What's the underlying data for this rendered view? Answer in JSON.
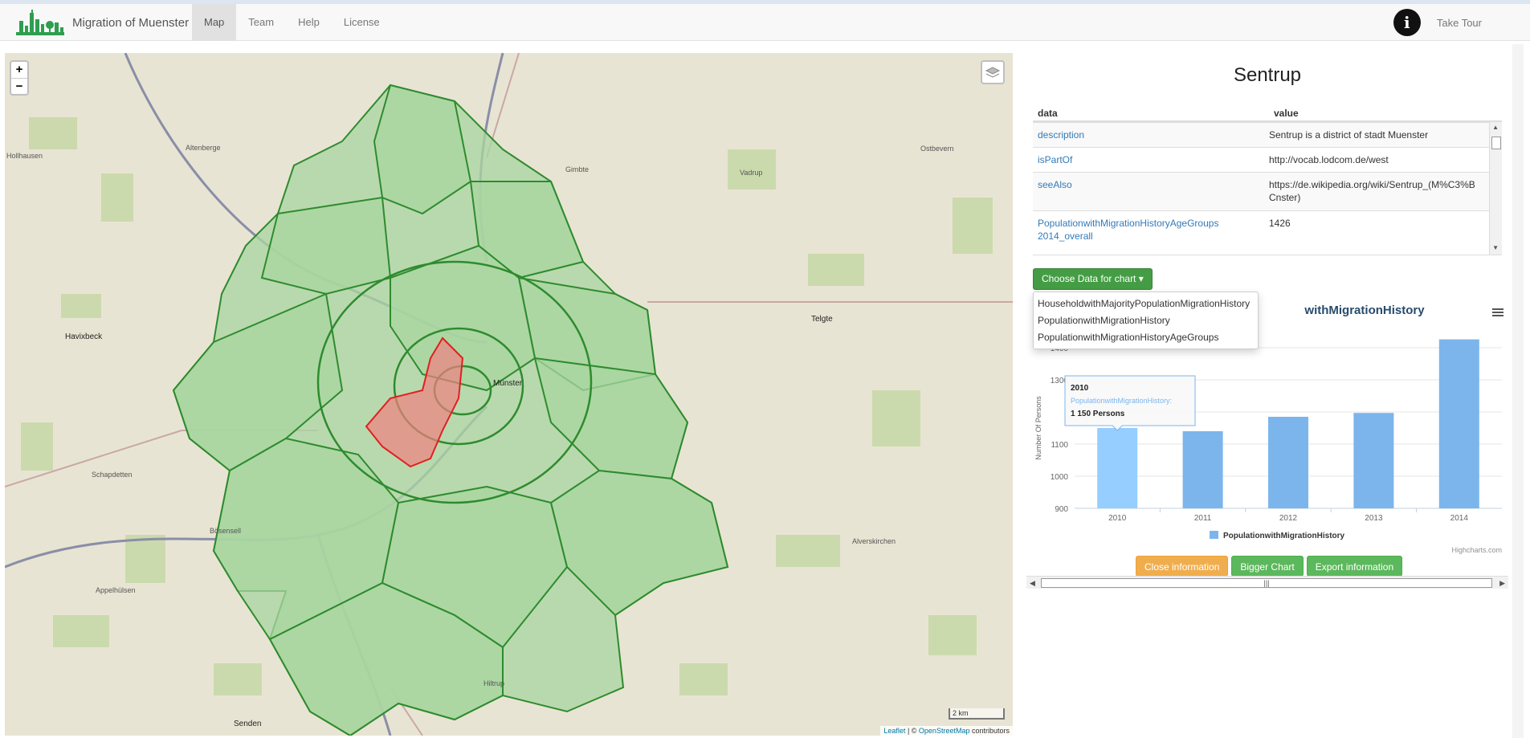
{
  "navbar": {
    "brand": "Migration of Muenster",
    "links": [
      "Map",
      "Team",
      "Help",
      "License"
    ],
    "active": "Map",
    "tour_label": "Take Tour",
    "info_glyph": "i"
  },
  "map": {
    "zoom_in": "+",
    "zoom_out": "−",
    "scale_label": "2 km",
    "attribution": {
      "leaflet": "Leaflet",
      "sep": " | © ",
      "osm": "OpenStreetMap",
      "rest": " contributors"
    },
    "places": [
      "Havixbeck",
      "Münster",
      "Telgte",
      "Senden",
      "Hiltrup",
      "Gimbte",
      "Altenberge",
      "Ostbevern",
      "Vadrup",
      "Schapdetten",
      "Bösensell",
      "Appelhülsen",
      "Alverskirchen",
      "Hollhausen"
    ],
    "selected_district_color": "#f08080",
    "district_color": "#4caf50"
  },
  "panel": {
    "district": "Sentrup",
    "table_headers": {
      "data": "data",
      "value": "value"
    },
    "rows": [
      {
        "key": "description",
        "value": "Sentrup is a district of stadt Muenster"
      },
      {
        "key": "isPartOf",
        "value": "http://vocab.lodcom.de/west"
      },
      {
        "key": "seeAlso",
        "value": "https://de.wikipedia.org/wiki/Sentrup_(M%C3%BCnster)"
      },
      {
        "key": "PopulationwithMigrationHistoryAgeGroups2014_overall",
        "value": "1426"
      }
    ],
    "chooser_label": "Choose Data for chart ▾",
    "dropdown": [
      "HouseholdwithMajorityPopulationMigrationHistory",
      "PopulationwithMigrationHistory",
      "PopulationwithMigrationHistoryAgeGroups"
    ],
    "chart_title_visible": "withMigrationHistory",
    "highcharts_credit": "Highcharts.com",
    "buttons": {
      "close": "Close information",
      "bigger": "Bigger Chart",
      "export": "Export information"
    },
    "hscroll_glyph": "|||"
  },
  "chart_data": {
    "type": "bar",
    "categories": [
      "2010",
      "2011",
      "2012",
      "2013",
      "2014"
    ],
    "series": [
      {
        "name": "PopulationwithMigrationHistory",
        "values": [
          1150,
          1140,
          1185,
          1197,
          1426
        ]
      }
    ],
    "ylabel": "Number Of Persons",
    "ylim": [
      900,
      1400
    ],
    "yticks": [
      900,
      1000,
      1100,
      1200,
      1300,
      1400
    ],
    "yticks_printed": [
      "900",
      "1000",
      "1100",
      "",
      "1300",
      "1400"
    ],
    "highlight_index": 0,
    "tooltip": {
      "title": "2010",
      "series": "PopulationwithMigrationHistory:",
      "value": "1 150 Persons"
    },
    "bar_color": "#7cb5ec",
    "highlight_color": "#95ceff",
    "legend": "bottom"
  }
}
